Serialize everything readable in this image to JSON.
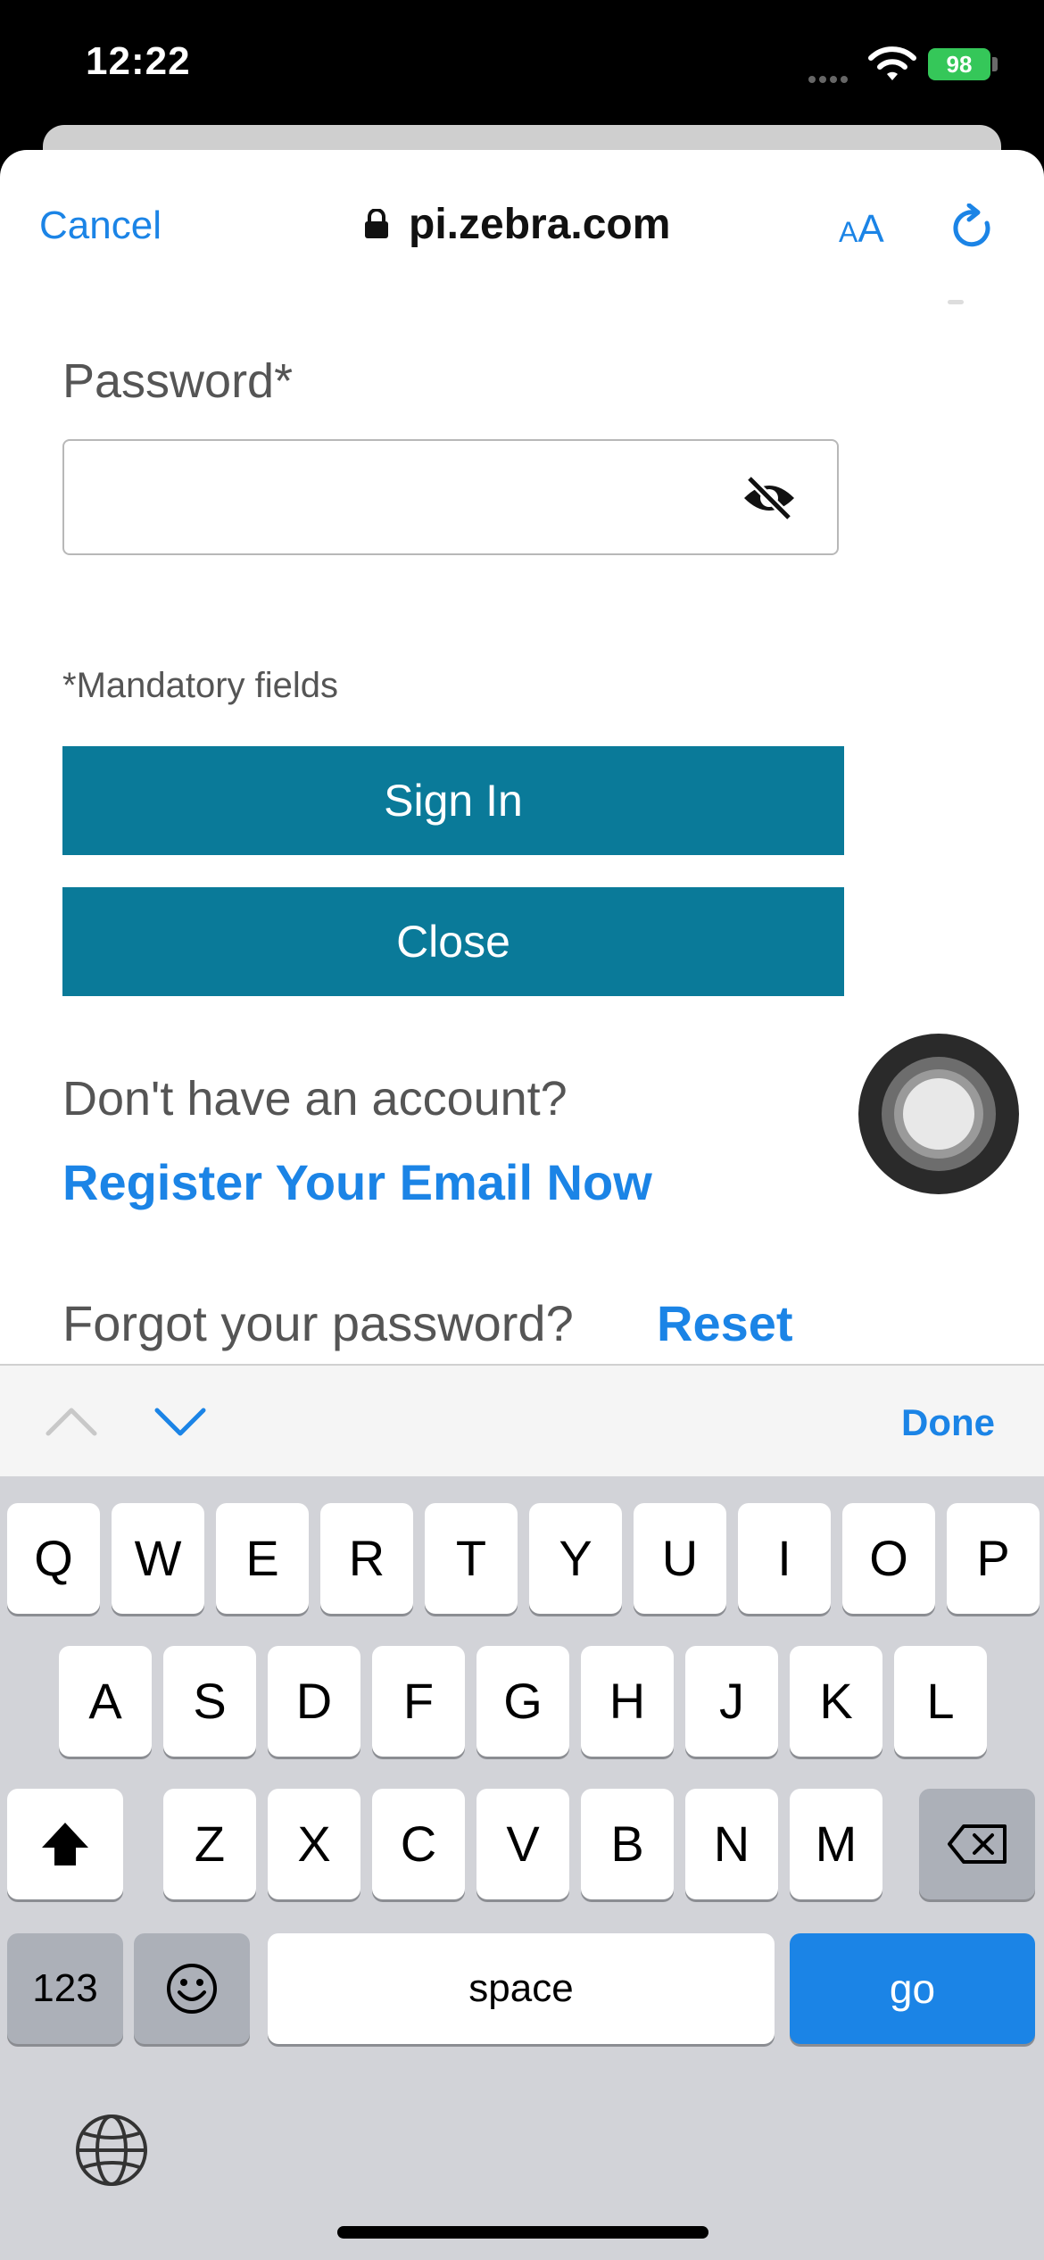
{
  "status_bar": {
    "time": "12:22",
    "battery": "98"
  },
  "browser": {
    "cancel_label": "Cancel",
    "url": "pi.zebra.com",
    "text_size_small": "A",
    "text_size_large": "A"
  },
  "form": {
    "password_label": "Password*",
    "password_value": "",
    "mandatory_note": "*Mandatory fields",
    "sign_in_label": "Sign In",
    "close_label": "Close",
    "no_account_text": "Don't have an account?",
    "register_link": "Register Your Email Now",
    "forgot_text": "Forgot your password?",
    "reset_link": "Reset"
  },
  "accessory_bar": {
    "done_label": "Done"
  },
  "keyboard": {
    "row1": [
      "Q",
      "W",
      "E",
      "R",
      "T",
      "Y",
      "U",
      "I",
      "O",
      "P"
    ],
    "row2": [
      "A",
      "S",
      "D",
      "F",
      "G",
      "H",
      "J",
      "K",
      "L"
    ],
    "row3": [
      "Z",
      "X",
      "C",
      "V",
      "B",
      "N",
      "M"
    ],
    "num_label": "123",
    "space_label": "space",
    "go_label": "go"
  },
  "colors": {
    "accent": "#1b84e6",
    "button": "#0a7a99",
    "battery": "#35c759"
  }
}
